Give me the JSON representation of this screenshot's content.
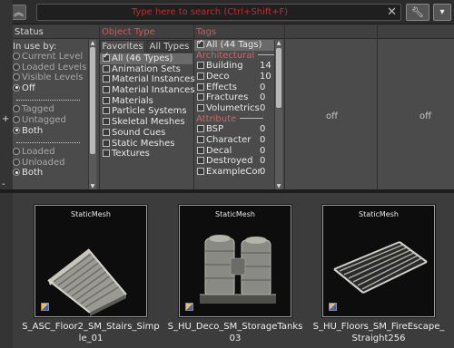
{
  "search": {
    "placeholder": "Type here to search (Ctrl+Shift+F)"
  },
  "toolbar": {
    "collapse_icon": "double-chevron-up-icon",
    "clear_icon": "close-icon",
    "key_icon": "key-icon",
    "options_icon": "triangle-down-icon"
  },
  "status": {
    "header": "Status",
    "in_use_title": "In use by:",
    "in_use_options": [
      "Current Level",
      "Loaded Levels",
      "Visible Levels",
      "Off"
    ],
    "in_use_selected": "Off",
    "tag_options": [
      "Tagged",
      "Untagged",
      "Both"
    ],
    "tag_selected": "Both",
    "load_options": [
      "Loaded",
      "Unloaded",
      "Both"
    ],
    "load_selected": "Both"
  },
  "object_type": {
    "header": "Object Type",
    "tabs": [
      "Favorites",
      "All Types"
    ],
    "active_tab": "Favorites",
    "items": [
      {
        "label": "All (46 Types)",
        "checked": true
      },
      {
        "label": "Animation Sets",
        "checked": false
      },
      {
        "label": "Material Instances",
        "checked": false
      },
      {
        "label": "Material Instances",
        "checked": false
      },
      {
        "label": "Materials",
        "checked": false
      },
      {
        "label": "Particle Systems",
        "checked": false
      },
      {
        "label": "Skeletal Meshes",
        "checked": false
      },
      {
        "label": "Sound Cues",
        "checked": false
      },
      {
        "label": "Static Meshes",
        "checked": false
      },
      {
        "label": "Textures",
        "checked": false
      }
    ]
  },
  "tags": {
    "header": "Tags",
    "all_label": "All (44 Tags)",
    "all_checked": true,
    "groups": [
      {
        "name": "Architectural",
        "items": [
          {
            "label": "Building",
            "count": "14"
          },
          {
            "label": "Deco",
            "count": "10"
          },
          {
            "label": "Effects",
            "count": "0"
          },
          {
            "label": "Fractures",
            "count": "0"
          },
          {
            "label": "Volumetrics",
            "count": "0"
          }
        ]
      },
      {
        "name": "Attribute",
        "items": [
          {
            "label": "BSP",
            "count": "0"
          },
          {
            "label": "Character",
            "count": "0"
          },
          {
            "label": "Decal",
            "count": "0"
          },
          {
            "label": "Destroyed",
            "count": "0"
          },
          {
            "label": "ExampleCor",
            "count": "0"
          }
        ]
      }
    ]
  },
  "extra_columns": [
    {
      "value": "off"
    },
    {
      "value": "off"
    }
  ],
  "assets": [
    {
      "type": "StaticMesh",
      "name": "S_ASC_Floor2_SM_Stairs_Simp le_01",
      "thumbnail": "stairs"
    },
    {
      "type": "StaticMesh",
      "name": "S_HU_Deco_SM_StorageTanks 03",
      "thumbnail": "tanks"
    },
    {
      "type": "StaticMesh",
      "name": "S_HU_Floors_SM_FireEscape_ Straight256",
      "thumbnail": "grate"
    }
  ],
  "colors": {
    "highlight_red": "#e05050",
    "panel_bg": "#4b4b4b"
  }
}
